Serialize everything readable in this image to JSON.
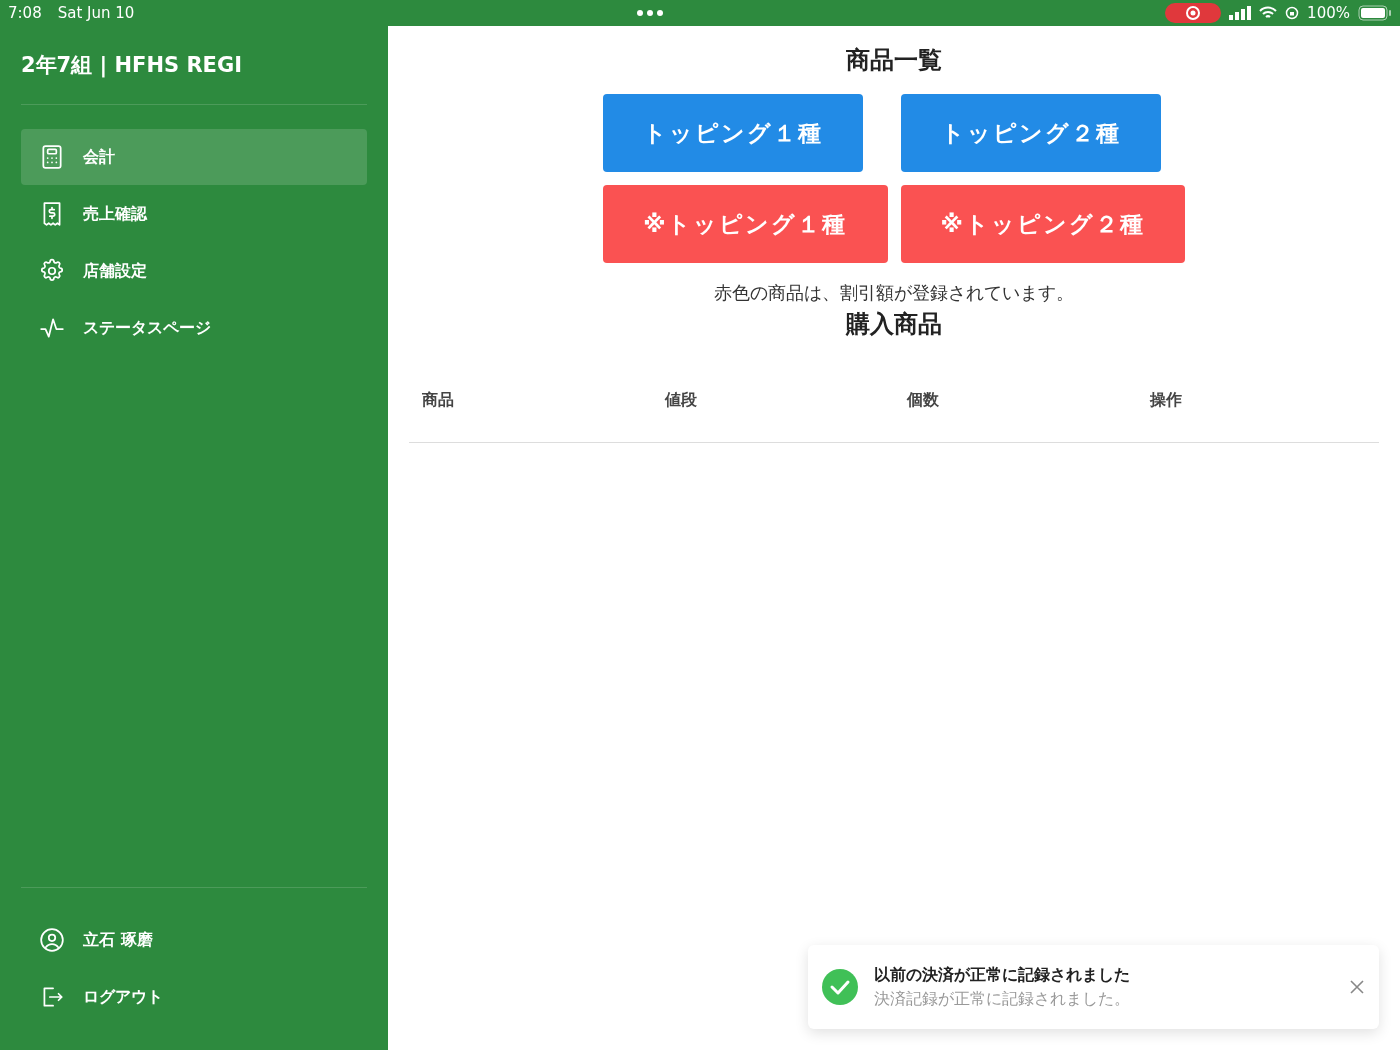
{
  "status_bar": {
    "time": "7:08",
    "date": "Sat Jun 10",
    "battery": "100%"
  },
  "sidebar": {
    "title": "2年7組 | HFHS REGI",
    "items": [
      {
        "label": "会計",
        "selected": true
      },
      {
        "label": "売上確認",
        "selected": false
      },
      {
        "label": "店舗設定",
        "selected": false
      },
      {
        "label": "ステータスページ",
        "selected": false
      }
    ],
    "footer_items": [
      {
        "label": "立石 琢磨"
      },
      {
        "label": "ログアウト"
      }
    ]
  },
  "products": {
    "title": "商品一覧",
    "items": [
      {
        "label": "トッピング１種",
        "kind": "regular"
      },
      {
        "label": "トッピング２種",
        "kind": "regular"
      },
      {
        "label": "※トッピング１種",
        "kind": "discounted"
      },
      {
        "label": "※トッピング２種",
        "kind": "discounted"
      }
    ],
    "note": "赤色の商品は、割引額が登録されています。"
  },
  "cart": {
    "title": "購入商品",
    "columns": [
      "商品",
      "値段",
      "個数",
      "操作"
    ]
  },
  "toast": {
    "title": "以前の決済が正常に記録されました",
    "message": "決済記録が正常に記録されました。"
  }
}
